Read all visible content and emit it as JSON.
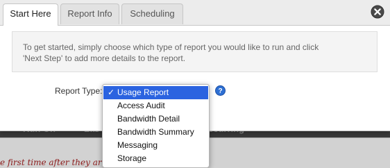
{
  "tabs": [
    {
      "label": "Start Here",
      "active": true
    },
    {
      "label": "Report Info",
      "active": false
    },
    {
      "label": "Scheduling",
      "active": false
    }
  ],
  "info": {
    "line1": "To get started, simply choose which type of report you would like to run and click",
    "line2": "'Next Step' to add more details to the report."
  },
  "report_type": {
    "label": "Report Type:",
    "selected": "Usage Report",
    "options": [
      "Usage Report",
      "Access Audit",
      "Bandwidth Detail",
      "Bandwidth Summary",
      "Messaging",
      "Storage"
    ]
  },
  "background": {
    "header_fragments": [
      "Run On",
      "Las",
      "ecurring"
    ],
    "row_fragment": "e first time after they are"
  },
  "colors": {
    "selected_highlight": "#2b63e0",
    "help_icon": "#2d6fd3",
    "background_header": "#3a3a3a"
  }
}
